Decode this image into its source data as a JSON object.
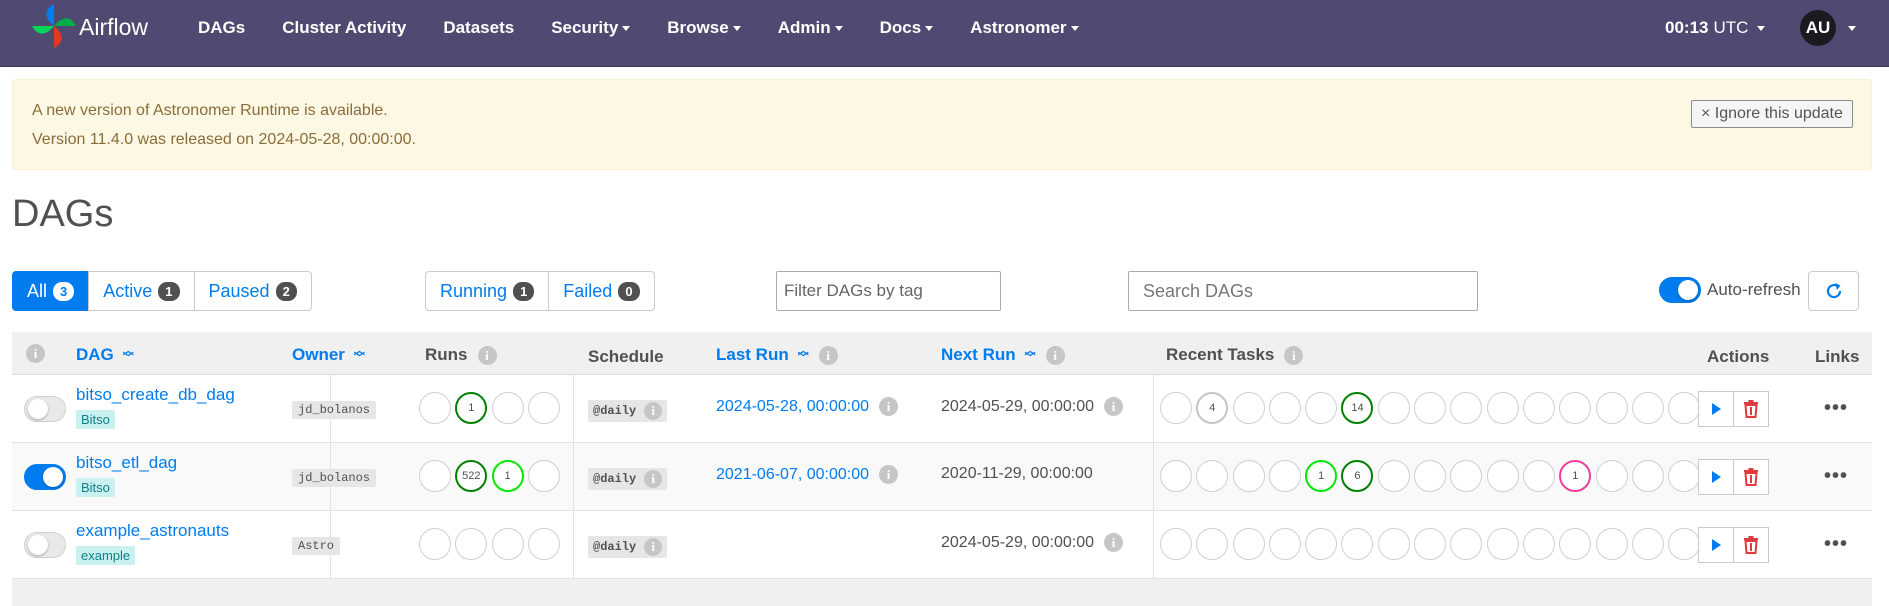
{
  "nav": {
    "brand": "Airflow",
    "items": [
      {
        "label": "DAGs",
        "dropdown": false
      },
      {
        "label": "Cluster Activity",
        "dropdown": false
      },
      {
        "label": "Datasets",
        "dropdown": false
      },
      {
        "label": "Security",
        "dropdown": true
      },
      {
        "label": "Browse",
        "dropdown": true
      },
      {
        "label": "Admin",
        "dropdown": true
      },
      {
        "label": "Docs",
        "dropdown": true
      },
      {
        "label": "Astronomer",
        "dropdown": true
      }
    ],
    "time": "00:13",
    "timezone": "UTC",
    "user_initials": "AU"
  },
  "alert": {
    "line1": "A new version of Astronomer Runtime is available.",
    "line2": "Version 11.4.0 was released on 2024-05-28, 00:00:00.",
    "dismiss_label": "× Ignore this update"
  },
  "page_title": "DAGs",
  "status_filter": {
    "all": {
      "label": "All",
      "count": "3"
    },
    "active": {
      "label": "Active",
      "count": "1"
    },
    "paused": {
      "label": "Paused",
      "count": "2"
    }
  },
  "run_filter": {
    "running": {
      "label": "Running",
      "count": "1"
    },
    "failed": {
      "label": "Failed",
      "count": "0"
    }
  },
  "tag_filter_placeholder": "Filter DAGs by tag",
  "search_placeholder": "Search DAGs",
  "auto_refresh": {
    "label": "Auto-refresh",
    "on": true
  },
  "table": {
    "headers": {
      "dag": "DAG",
      "owner": "Owner",
      "runs": "Runs",
      "schedule": "Schedule",
      "last_run": "Last Run",
      "next_run": "Next Run",
      "recent_tasks": "Recent Tasks",
      "actions": "Actions",
      "links": "Links"
    },
    "rows": [
      {
        "paused": true,
        "dag_id": "bitso_create_db_dag",
        "tag": "Bitso",
        "owner": "jd_bolanos",
        "runs": [
          "",
          "1",
          "",
          ""
        ],
        "schedule": "@daily",
        "last_run": "2024-05-28, 00:00:00",
        "next_run": "2024-05-29, 00:00:00",
        "tasks": [
          "",
          "4",
          "",
          "",
          "",
          "14",
          "",
          "",
          "",
          "",
          "",
          "",
          "",
          "",
          ""
        ]
      },
      {
        "paused": false,
        "dag_id": "bitso_etl_dag",
        "tag": "Bitso",
        "owner": "jd_bolanos",
        "runs": [
          "",
          "522",
          "1",
          ""
        ],
        "schedule": "@daily",
        "last_run": "2021-06-07, 00:00:00",
        "next_run": "2020-11-29, 00:00:00",
        "tasks": [
          "",
          "",
          "",
          "",
          "1",
          "6",
          "",
          "",
          "",
          "",
          "",
          "1",
          "",
          "",
          ""
        ]
      },
      {
        "paused": true,
        "dag_id": "example_astronauts",
        "tag": "example",
        "owner": "Astro",
        "runs": [
          "",
          "",
          "",
          ""
        ],
        "schedule": "@daily",
        "last_run": "",
        "next_run": "2024-05-29, 00:00:00",
        "tasks": [
          "",
          "",
          "",
          "",
          "",
          "",
          "",
          "",
          "",
          "",
          "",
          "",
          "",
          "",
          ""
        ]
      }
    ]
  },
  "colors": {
    "navbar": "#4f4a71",
    "link": "#017cee",
    "success": "#008000",
    "running": "#00e800",
    "up_for_retry": "#ee3fa0",
    "upstream_failed": "#c4c4c4",
    "delete": "#e0393e"
  }
}
